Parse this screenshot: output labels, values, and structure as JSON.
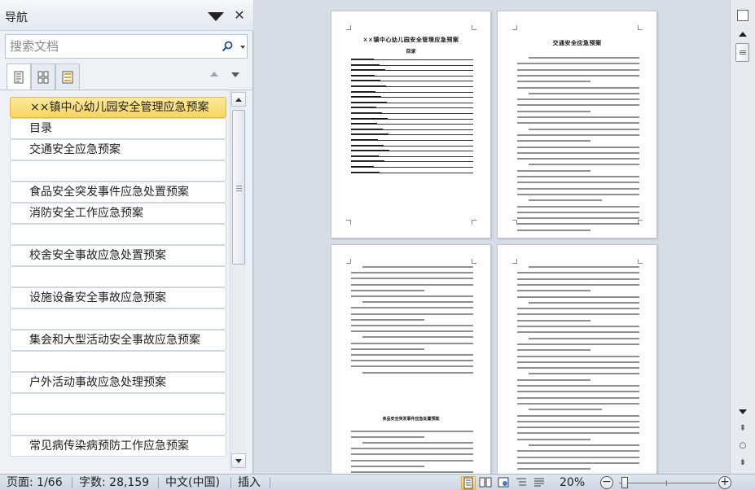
{
  "nav": {
    "title": "导航",
    "search_placeholder": "搜索文档",
    "headings": [
      {
        "text": "××镇中心幼儿园安全管理应急预案",
        "selected": true,
        "level": 1
      },
      {
        "text": "目录",
        "level": 2
      },
      {
        "text": "交通安全应急预案",
        "level": 2
      },
      {
        "text": "",
        "level": 2
      },
      {
        "text": "食品安全突发事件应急处置预案",
        "level": 2
      },
      {
        "text": "消防安全工作应急预案",
        "level": 2
      },
      {
        "text": "",
        "level": 2
      },
      {
        "text": "校舍安全事故应急处置预案",
        "level": 2
      },
      {
        "text": "",
        "level": 2
      },
      {
        "text": "设施设备安全事故应急预案",
        "level": 2
      },
      {
        "text": "",
        "level": 2
      },
      {
        "text": "集会和大型活动安全事故应急预案",
        "level": 2
      },
      {
        "text": "",
        "level": 2
      },
      {
        "text": "户外活动事故应急处理预案",
        "level": 2
      },
      {
        "text": "",
        "level": 2
      },
      {
        "text": "",
        "level": 2
      },
      {
        "text": "常见病传染病预防工作应急预案",
        "level": 2
      }
    ]
  },
  "document": {
    "page1_title": "××镇中心幼儿园安全管理应急预案",
    "page1_subtitle": "目录",
    "page2_title": "交通安全应急预案",
    "page3_section_title": "食品安全突发事件应急处置预案"
  },
  "status": {
    "page": "页面: 1/66",
    "words": "字数: 28,159",
    "language": "中文(中国)",
    "mode": "插入",
    "zoom": "20%"
  },
  "colors": {
    "selected_heading": "#f8d560",
    "status_bar": "#cdd7e4",
    "doc_background": "#d6dde7"
  }
}
